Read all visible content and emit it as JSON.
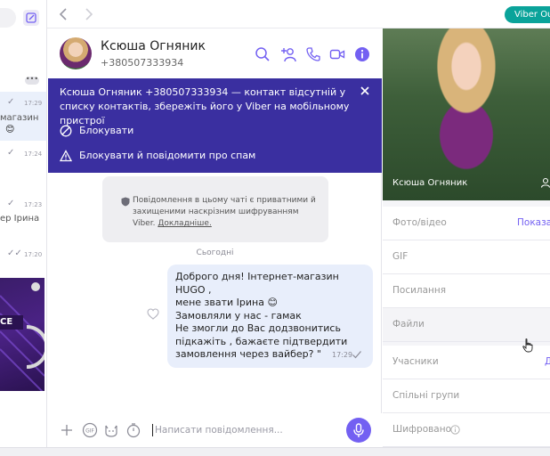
{
  "topbar": {
    "viber_out_label": "Viber Out"
  },
  "sidebar": {
    "rows": [
      {
        "time": "17:29",
        "text": "магазин"
      },
      {
        "time": "17:24",
        "text": ""
      },
      {
        "time": "17:23",
        "text": "ер Ірина"
      },
      {
        "time": "17:20",
        "text": ""
      }
    ],
    "ad_label": "CE"
  },
  "chat": {
    "contact_name": "Ксюша Огняник",
    "contact_phone": "+380507333934",
    "banner": {
      "text": "Ксюша Огняник +380507333934 — контакт відсутній у списку контактів, збережіть його у Viber на мобільному пристрої",
      "block_label": "Блокувати",
      "report_label": "Блокувати й повідомити про спам"
    },
    "encryption": {
      "text": "Повідомлення в цьому чаті є приватними й захищеними наскрізним шифруванням Viber.",
      "link": "Докладніше."
    },
    "date_separator": "Сьогодні",
    "message": {
      "text": "Доброго дня! Інтернет-магазин HUGO ,\nмене звати Ірина 😊\nЗамовляли у нас - гамак\nНе змогли до Вас додзвонитись\nпідкажіть , бажаєте підтвердити\nзамовлення через вайбер? \"",
      "time": "17:29"
    },
    "composer_placeholder": "Написати повідомлення..."
  },
  "details": {
    "photo_name": "Ксюша Огняник",
    "rows": {
      "media": "Фото/відео",
      "media_action": "Показати",
      "gif": "GIF",
      "links": "Посилання",
      "files": "Файли",
      "members": "Учасники",
      "members_action": "Д",
      "groups": "Спільні групи",
      "encrypted": "Шифровано"
    }
  },
  "colors": {
    "accent": "#7360f2",
    "banner": "#3a2fa0",
    "viber_out": "#0aa39a"
  }
}
